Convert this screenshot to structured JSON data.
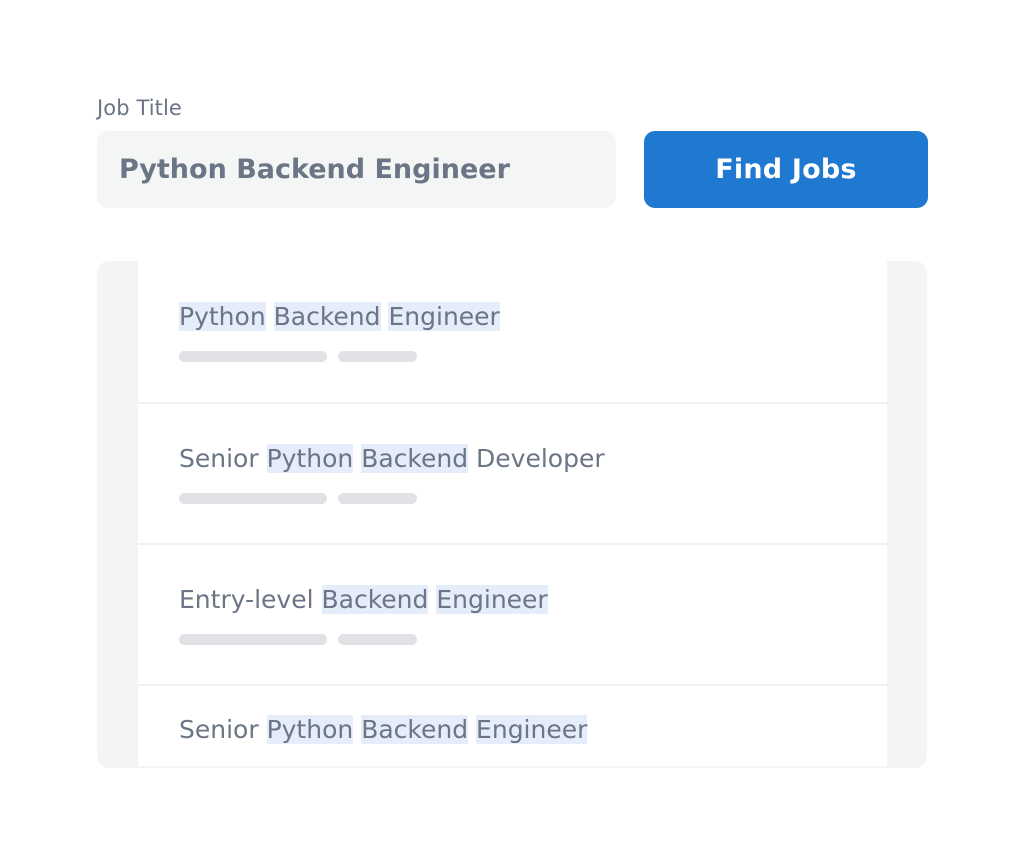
{
  "search": {
    "label": "Job Title",
    "input_value": "Python Backend Engineer",
    "input_placeholder": "Job Title",
    "button_label": "Find Jobs"
  },
  "colors": {
    "accent": "#1f79d0",
    "highlight": "#e5ecfa",
    "text": "#6b7585",
    "input_bg": "#f4f6f6",
    "panel_bg": "#f3f4f6",
    "skeleton": "#e0e2e5",
    "divider": "#eef0f2"
  },
  "results": {
    "items": [
      {
        "tokens": [
          {
            "text": "Python",
            "highlighted": true
          },
          {
            "text": " ",
            "highlighted": false
          },
          {
            "text": "Backend",
            "highlighted": true
          },
          {
            "text": " ",
            "highlighted": false
          },
          {
            "text": "Engineer",
            "highlighted": true
          }
        ],
        "full_title": "Python Backend Engineer",
        "skeleton_bars": 2,
        "clipped": false
      },
      {
        "tokens": [
          {
            "text": "Senior ",
            "highlighted": false
          },
          {
            "text": "Python",
            "highlighted": true
          },
          {
            "text": " ",
            "highlighted": false
          },
          {
            "text": "Backend",
            "highlighted": true
          },
          {
            "text": " Developer",
            "highlighted": false
          }
        ],
        "full_title": "Senior Python Backend Developer",
        "skeleton_bars": 2,
        "clipped": false
      },
      {
        "tokens": [
          {
            "text": "Entry-level ",
            "highlighted": false
          },
          {
            "text": "Backend",
            "highlighted": true
          },
          {
            "text": " ",
            "highlighted": false
          },
          {
            "text": "Engineer",
            "highlighted": true
          }
        ],
        "full_title": "Entry-level Backend Engineer",
        "skeleton_bars": 2,
        "clipped": false
      },
      {
        "tokens": [
          {
            "text": "Senior ",
            "highlighted": false
          },
          {
            "text": "Python",
            "highlighted": true
          },
          {
            "text": " ",
            "highlighted": false
          },
          {
            "text": "Backend",
            "highlighted": true
          },
          {
            "text": " ",
            "highlighted": false
          },
          {
            "text": "Engineer",
            "highlighted": true
          }
        ],
        "full_title": "Senior Python Backend Engineer",
        "skeleton_bars": 0,
        "clipped": true
      }
    ]
  }
}
